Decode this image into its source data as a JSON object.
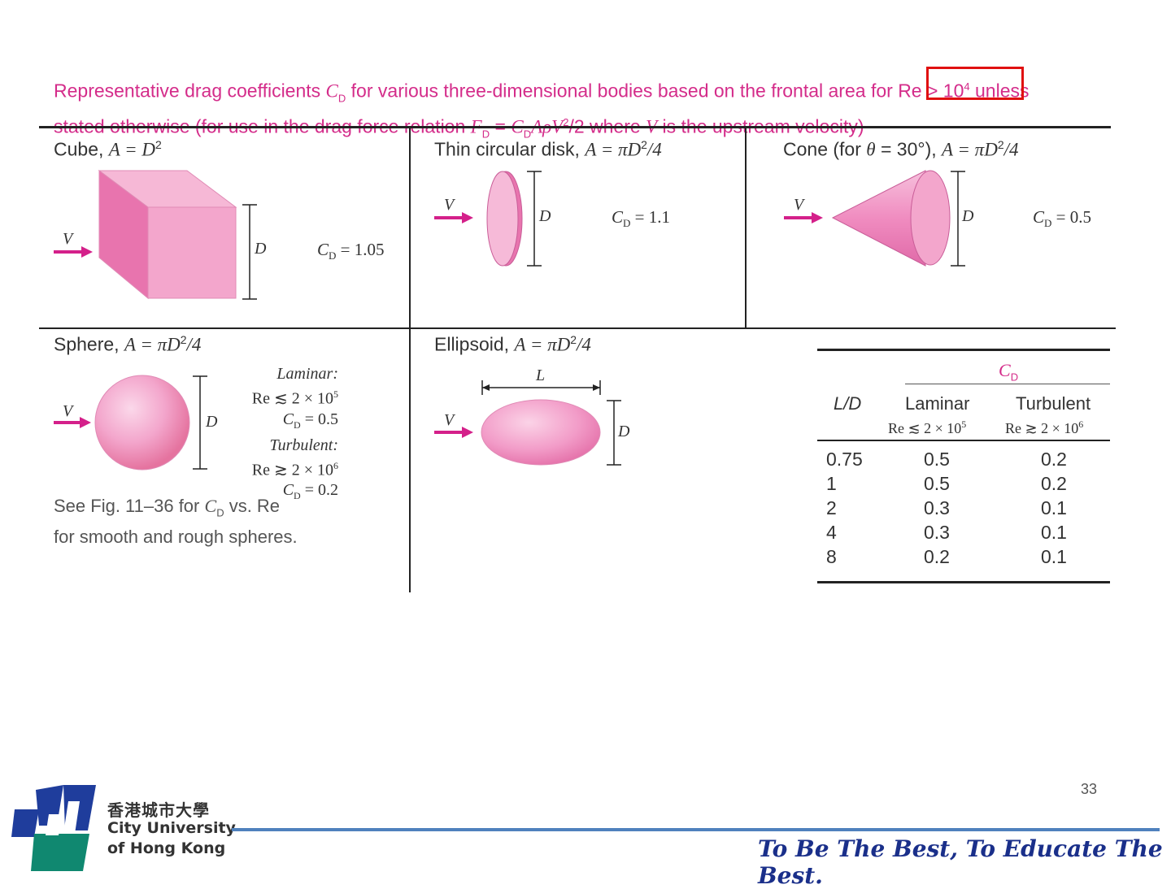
{
  "caption": {
    "line1_pre": "Representative drag coefficients ",
    "line1_cd": "C",
    "line1_cd_sub": "D",
    "line1_mid": " for various three-dimensional bodies based on the frontal area for ",
    "line1_re": "Re > 10",
    "line1_re_sup": "4",
    "line1_post": " unless",
    "line2_pre": "stated otherwise (for use in the drag force relation ",
    "line2_formula": "F",
    "line2_formula_sub": "D",
    "line2_eq": " = ",
    "line2_rhs": "C",
    "line2_rhs_sub": "D",
    "line2_rhs_rest": "AρV",
    "line2_rhs_sup": "2",
    "line2_rhs_end": "/2 where ",
    "line2_v": "V",
    "line2_post": " is the upstream velocity)"
  },
  "cells": {
    "cube": {
      "title": "Cube, ",
      "area": "A = D",
      "area_sup": "2",
      "v": "V",
      "d": "D",
      "cd": "C",
      "cd_sub": "D",
      "cd_val": " = 1.05"
    },
    "disk": {
      "title": "Thin circular disk, ",
      "area": "A = πD",
      "area_sup": "2",
      "area_end": "/4",
      "v": "V",
      "d": "D",
      "cd": "C",
      "cd_sub": "D",
      "cd_val": " = 1.1"
    },
    "cone": {
      "title": "Cone (for ",
      "theta": "θ",
      "title2": " = 30°), ",
      "area": "A = πD",
      "area_sup": "2",
      "area_end": "/4",
      "v": "V",
      "d": "D",
      "cd": "C",
      "cd_sub": "D",
      "cd_val": " = 0.5"
    },
    "sphere": {
      "title": "Sphere, ",
      "area": "A = πD",
      "area_sup": "2",
      "area_end": "/4",
      "v": "V",
      "d": "D",
      "laminar": "Laminar:",
      "lam_re": "Re ≲ 2 × 10",
      "lam_re_sup": "5",
      "lam_cd": "C",
      "lam_cd_sub": "D",
      "lam_cd_val": " = 0.5",
      "turbulent": "Turbulent:",
      "tur_re": "Re ≳ 2 × 10",
      "tur_re_sup": "6",
      "tur_cd": "C",
      "tur_cd_sub": "D",
      "tur_cd_val": " = 0.2",
      "note1_pre": "See Fig. 11–36 for ",
      "note1_cd": "C",
      "note1_cd_sub": "D",
      "note1_post": " vs. Re",
      "note2": "for smooth and rough spheres."
    },
    "ellipsoid": {
      "title": "Ellipsoid, ",
      "area": "A = πD",
      "area_sup": "2",
      "area_end": "/4",
      "v": "V",
      "d": "D",
      "l": "L"
    }
  },
  "table": {
    "cd_header": "C",
    "cd_header_sub": "D",
    "col_ld": "L/D",
    "col_laminar": "Laminar",
    "col_turbulent": "Turbulent",
    "sub_laminar": "Re ≲ 2 × 10",
    "sub_laminar_sup": "5",
    "sub_turbulent": "Re ≳ 2 × 10",
    "sub_turbulent_sup": "6",
    "rows": [
      {
        "ld": "0.75",
        "lam": "0.5",
        "tur": "0.2"
      },
      {
        "ld": "1",
        "lam": "0.5",
        "tur": "0.2"
      },
      {
        "ld": "2",
        "lam": "0.3",
        "tur": "0.1"
      },
      {
        "ld": "4",
        "lam": "0.3",
        "tur": "0.1"
      },
      {
        "ld": "8",
        "lam": "0.2",
        "tur": "0.1"
      }
    ]
  },
  "footer": {
    "page_number": "33",
    "logo_chinese": "香港城市大學",
    "logo_line1": "City University",
    "logo_line2": "of Hong Kong",
    "motto": "To Be The Best, To Educate The Best."
  },
  "colors": {
    "caption_pink": "#d42c8a",
    "arrow_magenta": "#d4208a",
    "body_pink": "#f3a6cc",
    "highlight_red": "#e01010",
    "motto_blue": "#1a2f8a",
    "footer_line": "#4f81bd"
  }
}
